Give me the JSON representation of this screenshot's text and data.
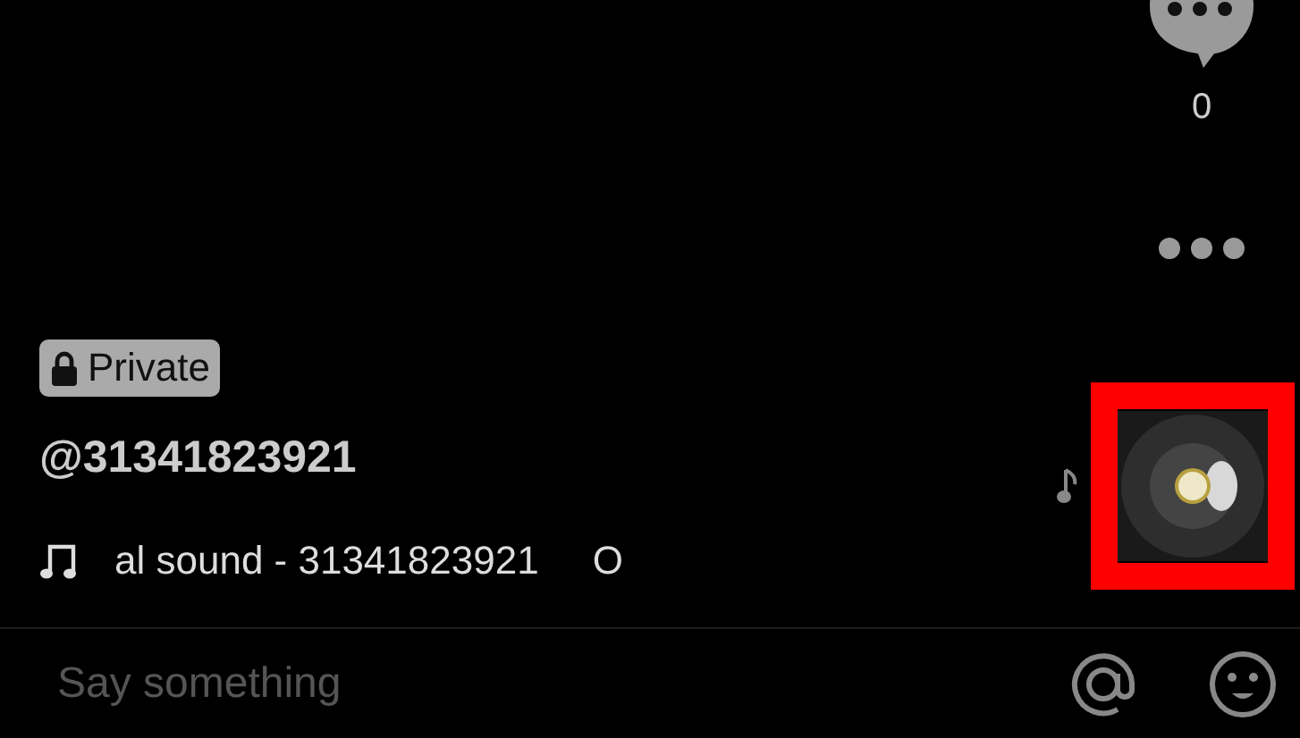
{
  "actions": {
    "comments": {
      "count": "0"
    }
  },
  "post": {
    "badge": {
      "label": "Private",
      "locked": true
    },
    "username": "@31341823921",
    "sound": {
      "title": "al sound - 31341823921",
      "next": "O"
    }
  },
  "music_disc": {
    "highlighted": true
  },
  "comment_bar": {
    "placeholder": "Say something"
  }
}
